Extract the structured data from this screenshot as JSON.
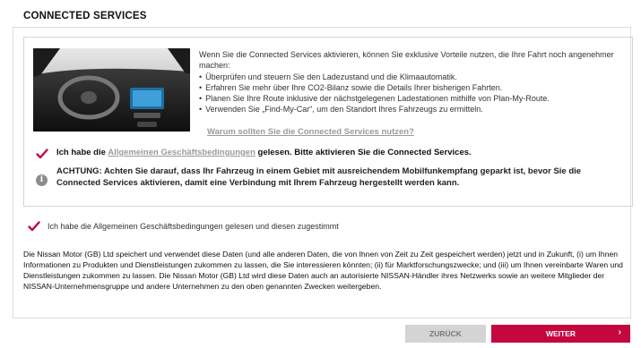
{
  "header": {
    "title": "CONNECTED SERVICES"
  },
  "info": {
    "intro": "Wenn Sie die Connected Services aktivieren, können Sie exklusive Vorteile nutzen, die Ihre Fahrt noch angenehmer machen:",
    "bullets": [
      "Überprüfen und steuern Sie den Ladezustand und die Klimaautomatik.",
      "Erfahren Sie mehr über Ihre CO2-Bilanz sowie die Details Ihrer bisherigen Fahrten.",
      "Planen Sie Ihre Route inklusive der nächstgelegenen Ladestationen mithilfe von Plan-My-Route.",
      "Verwenden Sie „Find-My-Car“, um den Standort Ihres Fahrzeugs zu ermitteln."
    ],
    "why_link": "Warum sollten Sie die Connected Services nutzen?"
  },
  "terms": {
    "prefix": "Ich habe die ",
    "link": "Allgemeinen Geschäftsbedingungen",
    "suffix": " gelesen. Bitte aktivieren Sie die Connected Services.",
    "checked": true
  },
  "warning": {
    "icon": "info-icon",
    "glyph": "i",
    "text": "ACHTUNG: Achten Sie darauf, dass Ihr Fahrzeug in einem Gebiet mit ausreichendem Mobilfunkempfang geparkt ist, bevor Sie die Connected Services aktivieren, damit eine Verbindung mit Ihrem Fahrzeug hergestellt werden kann."
  },
  "agree": {
    "text": "Ich habe die Allgemeinen Geschäftsbedingungen gelesen und diesen zugestimmt",
    "checked": true
  },
  "privacy": {
    "text": "Die Nissan Motor (GB) Ltd speichert und verwendet diese Daten (und alle anderen Daten, die von Ihnen von Zeit zu Zeit gespeichert werden) jetzt und in Zukunft, (i) um Ihnen Informationen zu Produkten und Dienstleistungen zukommen zu lassen, die Sie interessieren könnten; (ii) für Marktforschungszwecke; und (iii) um Ihnen vereinbarte Waren und Dienstleistungen zukommen zu lassen. Die Nissan Motor (GB) Ltd wird diese Daten auch an autorisierte NISSAN-Händler ihres Netzwerks sowie an weitere Mitglieder der NISSAN-Unternehmensgruppe und andere Unternehmen zu den oben genannten Zwecken weitergeben."
  },
  "buttons": {
    "back": "ZURÜCK",
    "next": "WEITER",
    "next_arrow": "›"
  },
  "colors": {
    "accent": "#c4083f",
    "check": "#c4083f",
    "link": "#9a9a9a",
    "button_back": "#d4d4d4"
  }
}
